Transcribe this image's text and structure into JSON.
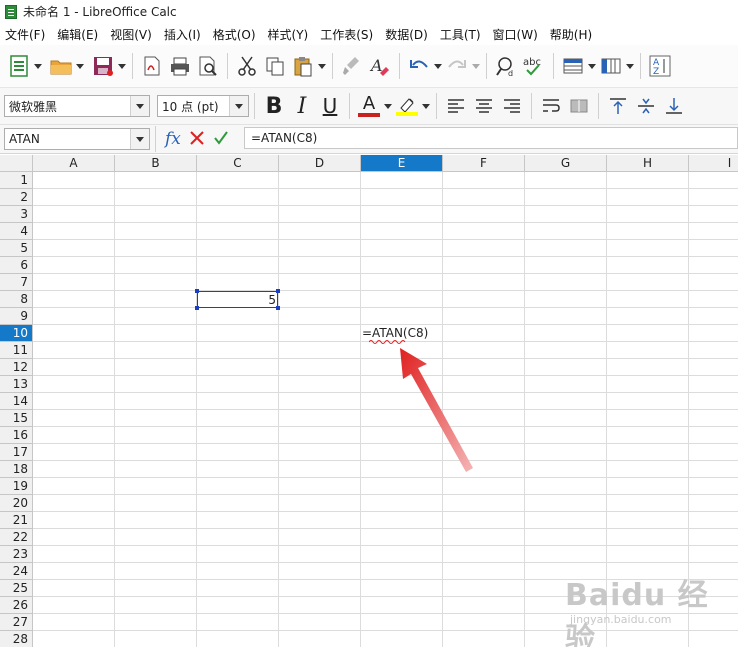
{
  "window": {
    "title": "未命名 1 - LibreOffice Calc"
  },
  "menu": [
    "文件(F)",
    "编辑(E)",
    "视图(V)",
    "插入(I)",
    "格式(O)",
    "样式(Y)",
    "工作表(S)",
    "数据(D)",
    "工具(T)",
    "窗口(W)",
    "帮助(H)"
  ],
  "format_toolbar": {
    "font_name": "微软雅黑",
    "font_size": "10 点 (pt)",
    "bold": "B",
    "italic": "I",
    "underline": "U",
    "font_color_glyph": "A"
  },
  "formula_bar": {
    "name_box": "ATAN",
    "function_wizard": "fx",
    "formula": "=ATAN(C8)"
  },
  "columns": [
    "A",
    "B",
    "C",
    "D",
    "E",
    "F",
    "G",
    "H",
    "I"
  ],
  "active_column": "E",
  "rows": [
    "1",
    "2",
    "3",
    "4",
    "5",
    "6",
    "7",
    "8",
    "9",
    "10",
    "11",
    "12",
    "13",
    "14",
    "15",
    "16",
    "17",
    "18",
    "19",
    "20",
    "21",
    "22",
    "23",
    "24",
    "25",
    "26",
    "27",
    "28"
  ],
  "active_row": "10",
  "cells": {
    "C8": "5",
    "E10": "=ATAN(C8)"
  },
  "watermark": {
    "text": "Baidu 经验",
    "sub": "jingyan.baidu.com"
  },
  "colors": {
    "accent": "#1479c9",
    "reference_border": "#1c3fbf",
    "arrow": "#e02020"
  }
}
